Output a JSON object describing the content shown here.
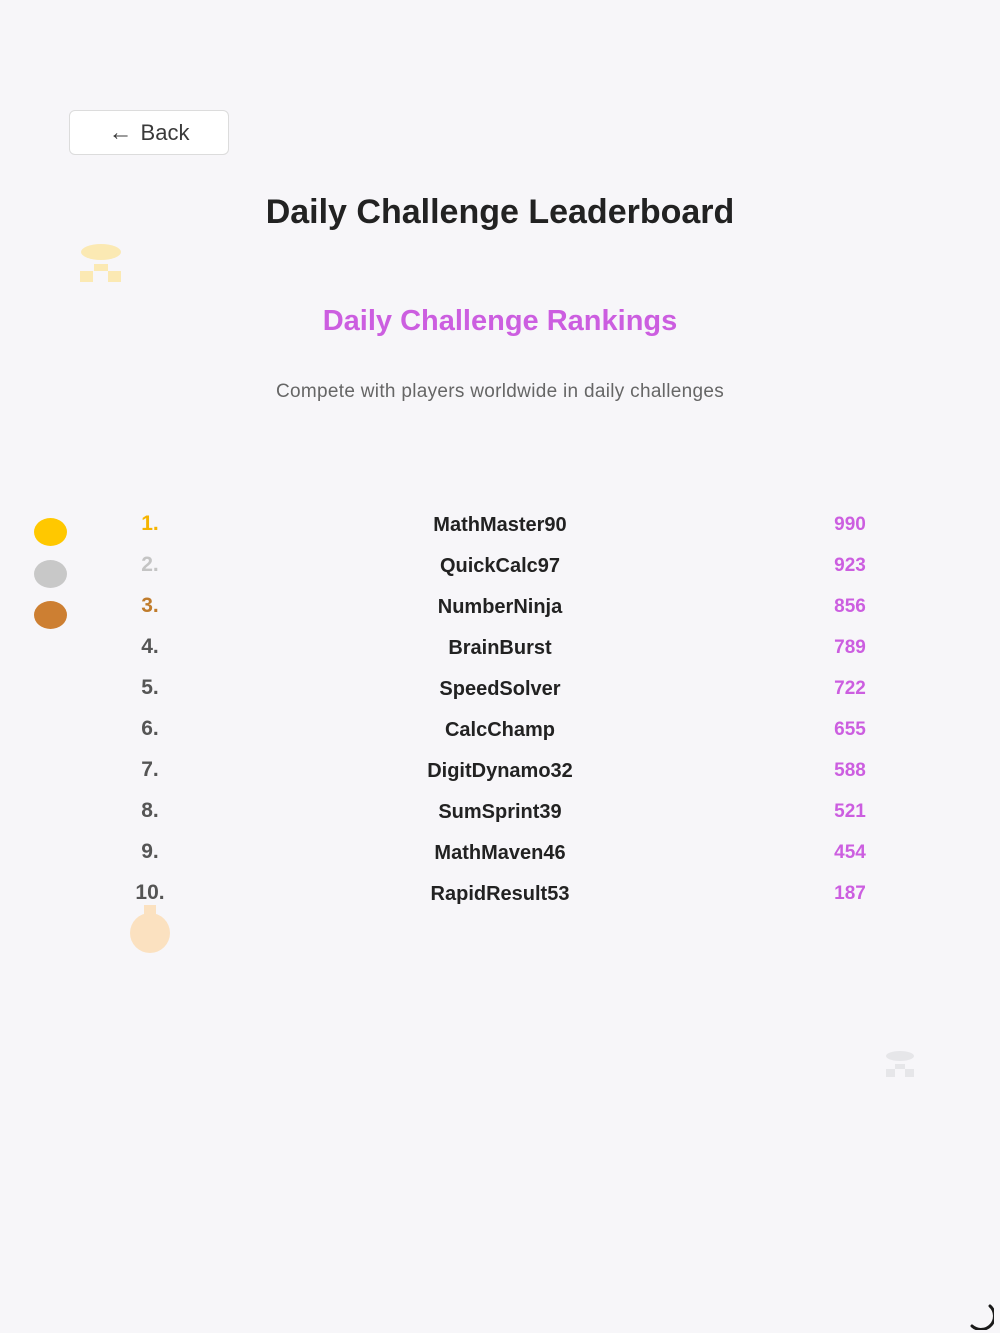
{
  "nav": {
    "back_arrow": "←",
    "back_label": "Back"
  },
  "header": {
    "title": "Daily Challenge Leaderboard"
  },
  "section": {
    "title": "Daily Challenge Rankings",
    "subtitle": "Compete with players worldwide in daily challenges"
  },
  "colors": {
    "accent": "#cc5ee0",
    "gold": "#ffc800",
    "silver": "#c8c8c8",
    "bronze": "#cd7f32",
    "rank_default": "#555555",
    "rank_silver_text": "#c4c4c4",
    "rank_gold_text": "#f5b400",
    "rank_bronze_text": "#c07c2c"
  },
  "icons": {
    "top_decoration": "trophy-icon",
    "medal_decoration": "medal-icon",
    "bottom_decoration": "trophy-icon",
    "loading": "spinner-icon"
  },
  "leaderboard": [
    {
      "rank": "1.",
      "name": "MathMaster90",
      "score": "990"
    },
    {
      "rank": "2.",
      "name": "QuickCalc97",
      "score": "923"
    },
    {
      "rank": "3.",
      "name": "NumberNinja",
      "score": "856"
    },
    {
      "rank": "4.",
      "name": "BrainBurst",
      "score": "789"
    },
    {
      "rank": "5.",
      "name": "SpeedSolver",
      "score": "722"
    },
    {
      "rank": "6.",
      "name": "CalcChamp",
      "score": "655"
    },
    {
      "rank": "7.",
      "name": "DigitDynamo32",
      "score": "588"
    },
    {
      "rank": "8.",
      "name": "SumSprint39",
      "score": "521"
    },
    {
      "rank": "9.",
      "name": "MathMaven46",
      "score": "454"
    },
    {
      "rank": "10.",
      "name": "RapidResult53",
      "score": "187"
    }
  ]
}
